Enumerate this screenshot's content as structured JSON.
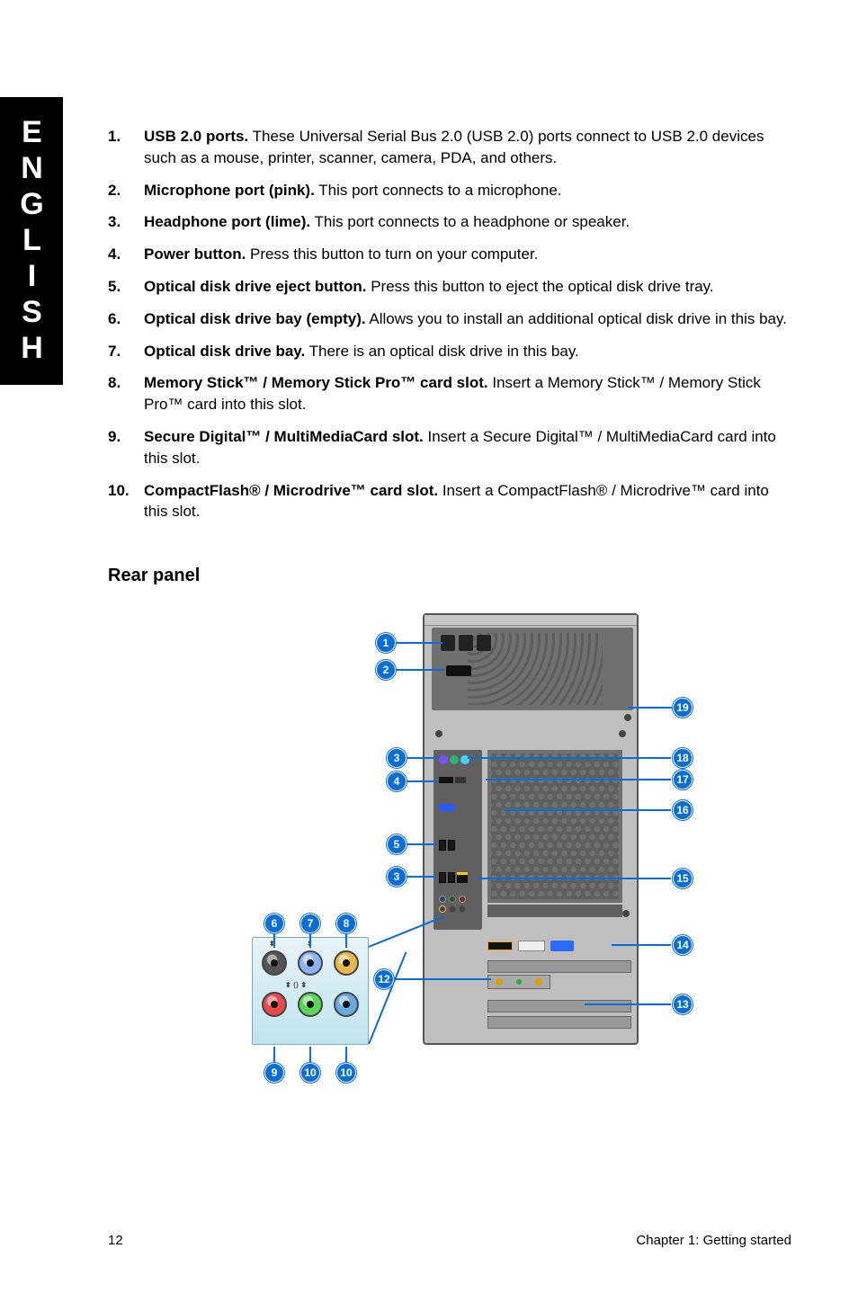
{
  "side_tab": "ENGLISH",
  "items": [
    {
      "num": "1.",
      "bold": "USB 2.0 ports.",
      "rest": " These Universal Serial Bus 2.0 (USB 2.0) ports connect to USB 2.0 devices such as a mouse, printer, scanner, camera, PDA, and others."
    },
    {
      "num": "2.",
      "bold": "Microphone port (pink).",
      "rest": " This port connects to a microphone."
    },
    {
      "num": "3.",
      "bold": "Headphone port (lime).",
      "rest": " This port connects to a headphone or speaker."
    },
    {
      "num": "4.",
      "bold": "Power button.",
      "rest": " Press this button to turn on your computer."
    },
    {
      "num": "5.",
      "bold": "Optical disk drive eject button.",
      "rest": " Press this button to eject the optical disk drive tray."
    },
    {
      "num": "6.",
      "bold": "Optical disk drive bay (empty).",
      "rest": " Allows you to install an additional optical disk drive in this bay."
    },
    {
      "num": "7.",
      "bold": "Optical disk drive bay.",
      "rest": " There is an optical disk drive in this bay."
    },
    {
      "num": "8.",
      "bold": "Memory Stick™ / Memory Stick Pro™ card slot.",
      "rest": " Insert a Memory Stick™ / Memory Stick Pro™ card into this slot."
    },
    {
      "num": "9.",
      "bold": "Secure Digital™ / MultiMediaCard slot.",
      "rest": " Insert a Secure Digital™ / MultiMediaCard card into this slot."
    },
    {
      "num": "10.",
      "bold": "CompactFlash® / Microdrive™ card slot.",
      "rest": " Insert a CompactFlash® / Microdrive™ card into this slot."
    }
  ],
  "section_head": "Rear panel",
  "callouts": {
    "c1": "1",
    "c2": "2",
    "c3": "3",
    "c3b": "3",
    "c4": "4",
    "c5": "5",
    "c6": "6",
    "c7": "7",
    "c8": "8",
    "c9": "9",
    "c10": "10",
    "c10b": "10",
    "c12": "12",
    "c13": "13",
    "c14": "14",
    "c15": "15",
    "c16": "16",
    "c17": "17",
    "c18": "18",
    "c19": "19"
  },
  "footer": {
    "page": "12",
    "chapter": "Chapter 1: Getting started"
  }
}
